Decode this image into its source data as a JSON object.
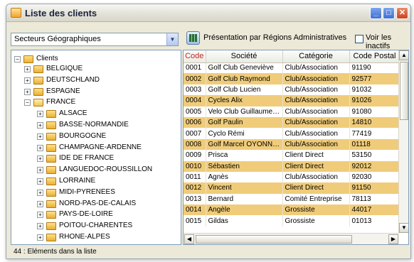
{
  "window": {
    "title": "Liste des clients",
    "minimize_icon": "minimize-icon",
    "maximize_icon": "maximize-icon",
    "close_icon": "close-icon"
  },
  "toolbar": {
    "selector_value": "Secteurs Géographiques",
    "presentation_label": "Présentation par Régions Administratives",
    "inactive_label": "Voir les inactifs",
    "inactive_checked": false
  },
  "tree": {
    "root": "Clients",
    "nodes": [
      {
        "label": "BELGIQUE",
        "level": 1,
        "expanded": false
      },
      {
        "label": "DEUTSCHLAND",
        "level": 1,
        "expanded": false
      },
      {
        "label": "ESPAGNE",
        "level": 1,
        "expanded": false
      },
      {
        "label": "FRANCE",
        "level": 1,
        "expanded": true
      },
      {
        "label": "ALSACE",
        "level": 2,
        "expanded": false
      },
      {
        "label": "BASSE-NORMANDIE",
        "level": 2,
        "expanded": false
      },
      {
        "label": "BOURGOGNE",
        "level": 2,
        "expanded": false
      },
      {
        "label": "CHAMPAGNE-ARDENNE",
        "level": 2,
        "expanded": false
      },
      {
        "label": "IDE DE FRANCE",
        "level": 2,
        "expanded": false
      },
      {
        "label": "LANGUEDOC-ROUSSILLON",
        "level": 2,
        "expanded": false
      },
      {
        "label": "LORRAINE",
        "level": 2,
        "expanded": false
      },
      {
        "label": "MIDI-PYRENEES",
        "level": 2,
        "expanded": false
      },
      {
        "label": "NORD-PAS-DE-CALAIS",
        "level": 2,
        "expanded": false
      },
      {
        "label": "PAYS-DE-LOIRE",
        "level": 2,
        "expanded": false
      },
      {
        "label": "POITOU-CHARENTES",
        "level": 2,
        "expanded": false
      },
      {
        "label": "RHONE-ALPES",
        "level": 2,
        "expanded": false
      }
    ]
  },
  "table": {
    "columns": [
      "Code",
      "Société",
      "Catégorie",
      "Code Postal"
    ],
    "rows": [
      [
        "0001",
        "Golf Club Geneviève",
        "Club/Association",
        "91190"
      ],
      [
        "0002",
        "Golf Club Raymond",
        "Club/Association",
        "92577"
      ],
      [
        "0003",
        "Golf Club Lucien",
        "Club/Association",
        "91032"
      ],
      [
        "0004",
        "Cycles Alix",
        "Club/Association",
        "91026"
      ],
      [
        "0005",
        "Velo Club Guillaume C...",
        "Club/Association",
        "91080"
      ],
      [
        "0006",
        "Golf Paulin",
        "Club/Association",
        "14810"
      ],
      [
        "0007",
        "Cyclo Rémi",
        "Club/Association",
        "77419"
      ],
      [
        "0008",
        "Golf Marcel OYONNAX",
        "Club/Association",
        "01118"
      ],
      [
        "0009",
        "Prisca",
        "Client Direct",
        "53150"
      ],
      [
        "0010",
        "Sébastien",
        "Client Direct",
        "92012"
      ],
      [
        "0011",
        "Agnès",
        "Club/Association",
        "92030"
      ],
      [
        "0012",
        "Vincent",
        "Client Direct",
        "91150"
      ],
      [
        "0013",
        "Bernard",
        "Comité Entreprise",
        "78113"
      ],
      [
        "0014",
        "Angèle",
        "Grossiste",
        "44017"
      ],
      [
        "0015",
        "Gildas",
        "Grossiste",
        "01013"
      ]
    ],
    "alt_row_color": "#f0cc7a"
  },
  "status": {
    "text": "44 : Eléments dans la liste"
  }
}
